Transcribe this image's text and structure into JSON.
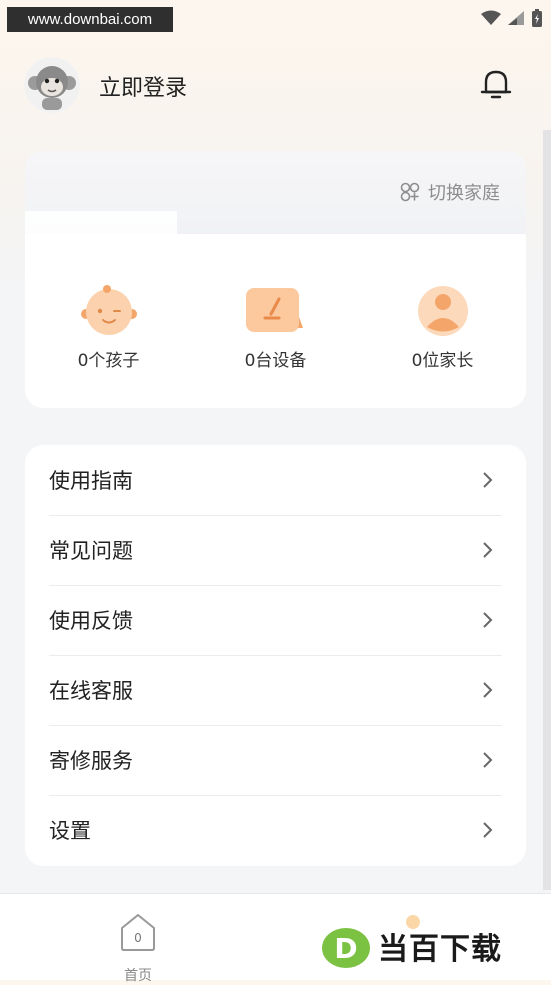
{
  "status_bar": {
    "watermark": "www.downbai.com"
  },
  "header": {
    "login_text": "立即登录"
  },
  "family_card": {
    "switch_label": "切换家庭",
    "stats": [
      {
        "label": "0个孩子",
        "icon": "child-face-icon"
      },
      {
        "label": "0台设备",
        "icon": "device-pen-icon"
      },
      {
        "label": "0位家长",
        "icon": "parent-person-icon"
      }
    ]
  },
  "menu": {
    "items": [
      {
        "label": "使用指南"
      },
      {
        "label": "常见问题"
      },
      {
        "label": "使用反馈"
      },
      {
        "label": "在线客服"
      },
      {
        "label": "寄修服务"
      },
      {
        "label": "设置"
      }
    ]
  },
  "tabbar": {
    "home_label": "首页",
    "home_badge": "0"
  },
  "brand": {
    "text": "当百下载",
    "letter": "D"
  },
  "colors": {
    "accent": "#f3a86a",
    "brand_green": "#7cc242",
    "text_primary": "#222222",
    "text_muted": "#8d8d8d"
  }
}
